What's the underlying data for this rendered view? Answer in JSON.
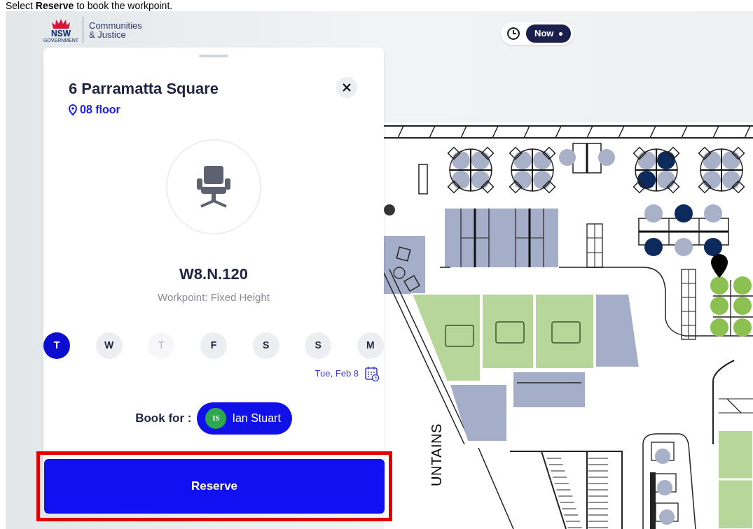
{
  "instruction": "Select **Reserve** to book the workpoint.",
  "logo": {
    "wordmark": "NSW",
    "sub": "GOVERNMENT",
    "department": [
      "Communities",
      "& Justice"
    ]
  },
  "time_toggle": {
    "label": "Now"
  },
  "panel": {
    "title": "6 Parramatta Square",
    "floor": "08 floor",
    "workpoint_id": "W8.N.120",
    "workpoint_type": "Workpoint: Fixed Height",
    "days": [
      {
        "label": "T",
        "selected": true,
        "disabled": false
      },
      {
        "label": "W",
        "selected": false,
        "disabled": false
      },
      {
        "label": "T",
        "selected": false,
        "disabled": true
      },
      {
        "label": "F",
        "selected": false,
        "disabled": false
      },
      {
        "label": "S",
        "selected": false,
        "disabled": false
      },
      {
        "label": "S",
        "selected": false,
        "disabled": false
      },
      {
        "label": "M",
        "selected": false,
        "disabled": false
      }
    ],
    "date": "Tue, Feb 8",
    "book_for": {
      "label": "Book for :",
      "initials": "IS",
      "name": "Ian Stuart"
    }
  },
  "reserve_button": {
    "label": "Reserve",
    "highlighted": true
  },
  "map": {
    "label": "UNTAINS"
  }
}
